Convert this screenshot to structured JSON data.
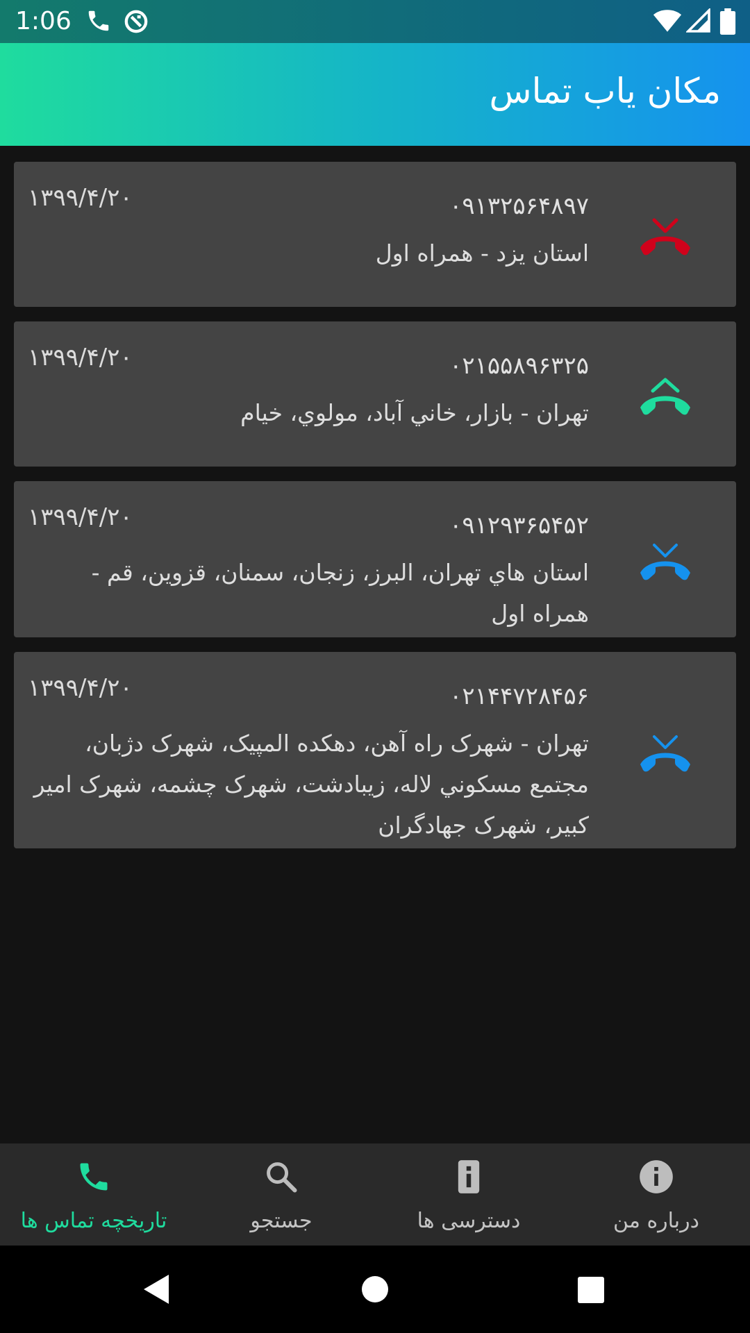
{
  "status_bar": {
    "time": "1:06",
    "left_icons": [
      "phone-icon",
      "sync-icon"
    ],
    "right_icons": [
      "wifi-icon",
      "signal-icon",
      "battery-icon"
    ]
  },
  "app_bar": {
    "title": "مکان یاب تماس"
  },
  "calls": [
    {
      "type": "missed",
      "icon": "missed-call-icon",
      "color": "#d0021b",
      "number": "۰۹۱۳۲۵۶۴۸۹۷",
      "date": "۱۳۹۹/۴/۲۰",
      "location": "استان یزد - همراه اول"
    },
    {
      "type": "outgoing",
      "icon": "outgoing-call-icon",
      "color": "#1fdc9e",
      "number": "۰۲۱۵۵۸۹۶۳۲۵",
      "date": "۱۳۹۹/۴/۲۰",
      "location": "تهران - بازار، خاني آباد، مولوي، خيام"
    },
    {
      "type": "incoming",
      "icon": "incoming-call-icon",
      "color": "#1592ee",
      "number": "۰۹۱۲۹۳۶۵۴۵۲",
      "date": "۱۳۹۹/۴/۲۰",
      "location": "استان هاي تهران، البرز، زنجان، سمنان، قزوين، قم - همراه اول"
    },
    {
      "type": "incoming",
      "icon": "incoming-call-icon",
      "color": "#1592ee",
      "number": "۰۲۱۴۴۷۲۸۴۵۶",
      "date": "۱۳۹۹/۴/۲۰",
      "location": "تهران - شهرک راه آهن، دهکده المپيک، شهرک دژبان، مجتمع مسکوني لاله، زيبادشت، شهرک چشمه، شهرک امير کبير، شهرک جهادگران"
    }
  ],
  "bottom_nav": [
    {
      "label": "تاريخچه تماس ها",
      "icon": "phone-icon",
      "active": true
    },
    {
      "label": "جستجو",
      "icon": "search-icon",
      "active": false
    },
    {
      "label": "دسترسی ها",
      "icon": "permissions-icon",
      "active": false
    },
    {
      "label": "درباره من",
      "icon": "info-icon",
      "active": false
    }
  ],
  "colors": {
    "accent": "#1fdc9e",
    "gradient_end": "#1592ee",
    "card": "#444444",
    "background": "#131313"
  },
  "system_nav": [
    "back-button",
    "home-button",
    "recents-button"
  ]
}
